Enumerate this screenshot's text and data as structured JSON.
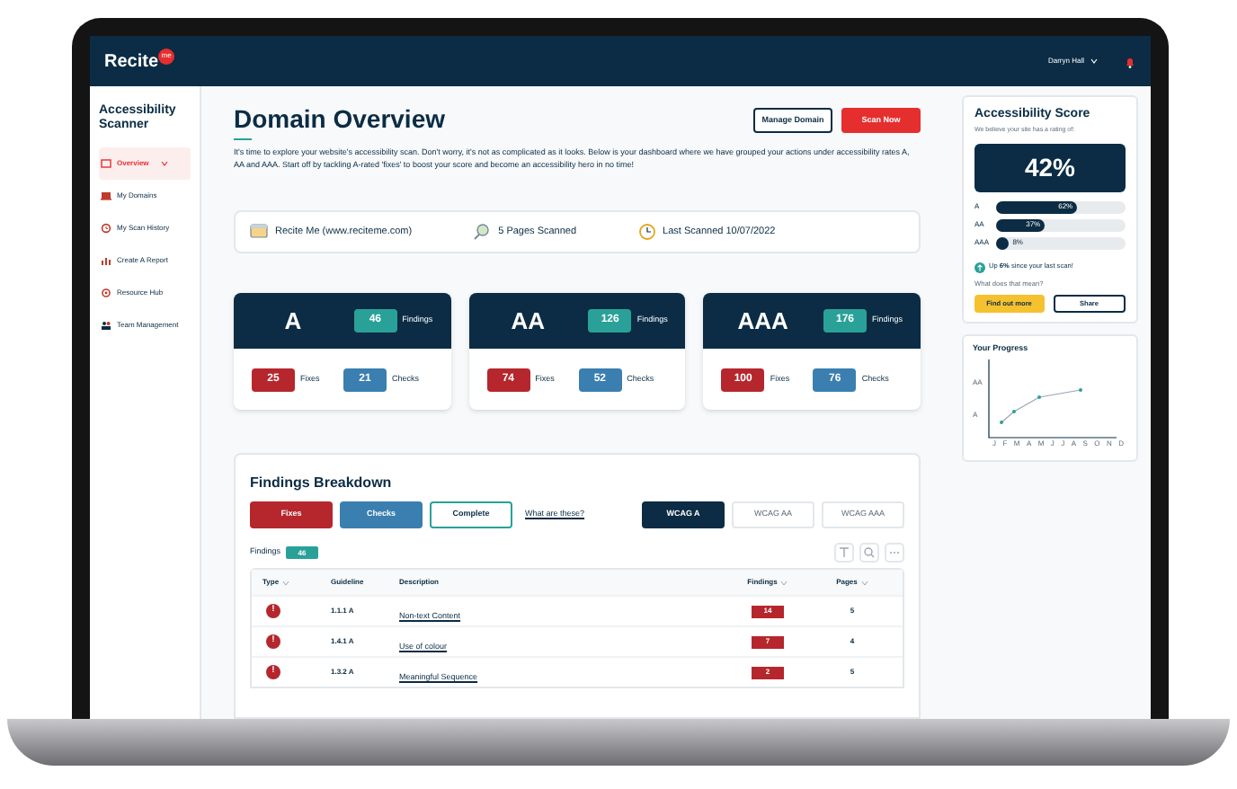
{
  "header": {
    "logo": "Recite",
    "logo_badge": "me",
    "user": "Darryn Hall"
  },
  "sidebar": {
    "title": "Accessibility Scanner",
    "items": [
      {
        "label": "Overview",
        "selected": true
      },
      {
        "label": "My Domains",
        "selected": false
      },
      {
        "label": "My Scan History",
        "selected": false
      },
      {
        "label": "Create A Report",
        "selected": false
      },
      {
        "label": "Resource Hub",
        "selected": false
      },
      {
        "label": "Team Management",
        "selected": false
      }
    ]
  },
  "page": {
    "title": "Domain Overview",
    "buttons": [
      {
        "label": "Manage Domain",
        "kind": "outline"
      },
      {
        "label": "Scan Now",
        "kind": "primary"
      }
    ],
    "intro": "It's time to explore your website's accessibility scan. Don't worry, it's not as complicated as it looks. Below is your dashboard where we have grouped your actions under accessibility rates A, AA and AAA. Start off by tackling A-rated 'fixes' to boost your score and become an accessibility hero in no time!"
  },
  "info": [
    {
      "kind": "site",
      "text": "Recite Me (www.reciteme.com)"
    },
    {
      "kind": "pages",
      "text": "5 Pages Scanned"
    },
    {
      "kind": "date",
      "text": "Last Scanned 10/07/2022"
    }
  ],
  "levels": [
    {
      "name": "A",
      "findings": "46",
      "findings_label": "Findings",
      "fixes": "25",
      "fixes_label": "Fixes",
      "checks": "21",
      "checks_label": "Checks"
    },
    {
      "name": "AA",
      "findings": "126",
      "findings_label": "Findings",
      "fixes": "74",
      "fixes_label": "Fixes",
      "checks": "52",
      "checks_label": "Checks"
    },
    {
      "name": "AAA",
      "findings": "176",
      "findings_label": "Findings",
      "fixes": "100",
      "fixes_label": "Fixes",
      "checks": "76",
      "checks_label": "Checks"
    }
  ],
  "breakdown": {
    "title": "Findings Breakdown",
    "filters": [
      {
        "label": "Fixes",
        "kind": "fixes"
      },
      {
        "label": "Checks",
        "kind": "checks"
      },
      {
        "label": "Complete",
        "kind": "complete"
      }
    ],
    "help_link": "What are these?",
    "tabs": [
      {
        "label": "WCAG A",
        "selected": true
      },
      {
        "label": "WCAG AA",
        "selected": false
      },
      {
        "label": "WCAG AAA",
        "selected": false
      }
    ],
    "count_label": "Findings",
    "count": "46",
    "table": {
      "columns": [
        {
          "label": "Type",
          "sortable": true
        },
        {
          "label": "Guideline",
          "sortable": false
        },
        {
          "label": "Description",
          "sortable": false
        },
        {
          "label": "Findings",
          "sortable": true
        },
        {
          "label": "Pages",
          "sortable": true
        }
      ],
      "rows": [
        {
          "type_icon": "!",
          "guideline": "1.1.1 A",
          "description": "Non-text Content",
          "findings": "14",
          "pages": "5"
        },
        {
          "type_icon": "!",
          "guideline": "1.4.1 A",
          "description": "Use of colour",
          "findings": "7",
          "pages": "4"
        },
        {
          "type_icon": "!",
          "guideline": "1.3.2 A",
          "description": "Meaningful Sequence",
          "findings": "2",
          "pages": "5"
        }
      ]
    }
  },
  "score": {
    "title": "Accessibility Score",
    "subtitle": "We believe your site has a rating of:",
    "value": "42%",
    "bars": [
      {
        "label": "A",
        "level": 0.62,
        "reading": "62%",
        "inside": true
      },
      {
        "label": "AA",
        "level": 0.37,
        "reading": "37%",
        "inside": true
      },
      {
        "label": "AAA",
        "level": 0.08,
        "reading": "8%",
        "inside": false
      }
    ],
    "trend": "Up **6%** since your last scan!",
    "question": "What does that mean?",
    "buttons": [
      {
        "label": "Find out more",
        "kind": "primary"
      },
      {
        "label": "Share",
        "kind": "outline"
      }
    ]
  },
  "progress": {
    "title": "Your Progress",
    "y_labels": [
      "AA",
      "A"
    ],
    "x_labels": [
      "J",
      "F",
      "M",
      "A",
      "M",
      "J",
      "J",
      "A",
      "S",
      "O",
      "N",
      "D"
    ]
  }
}
